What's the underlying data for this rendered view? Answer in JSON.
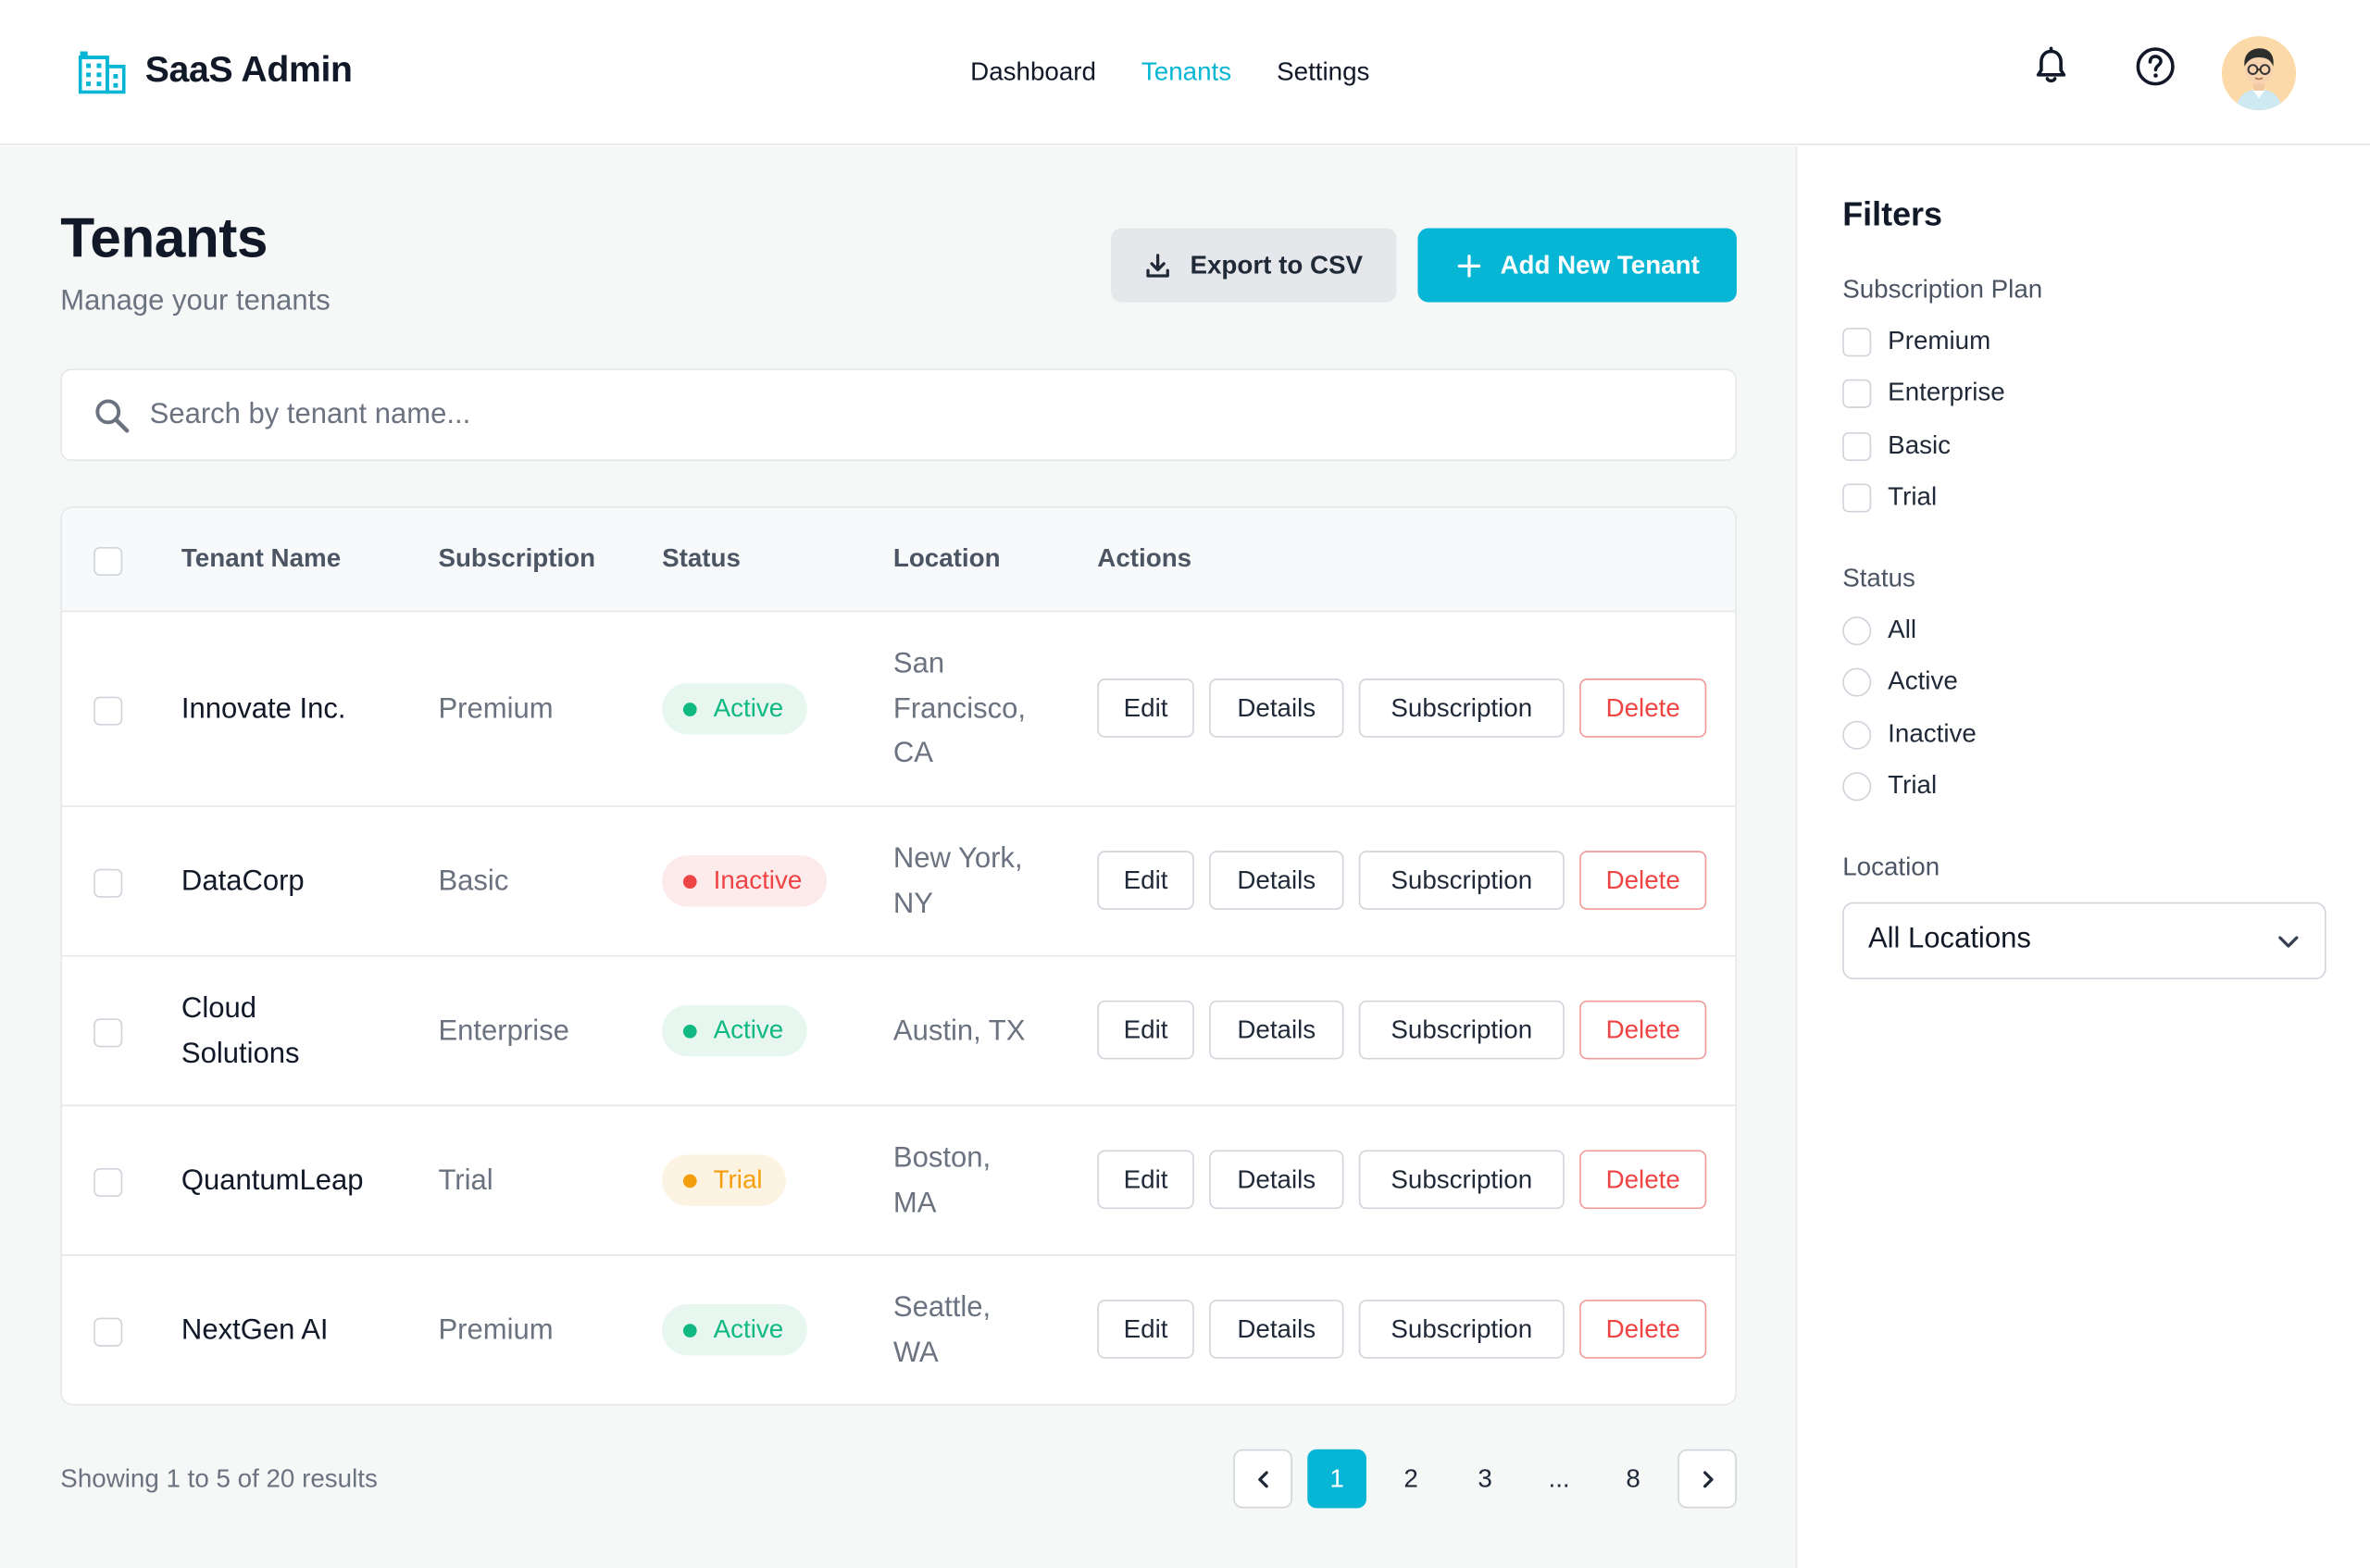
{
  "header": {
    "brand": "SaaS Admin",
    "nav": [
      {
        "label": "Dashboard",
        "active": false
      },
      {
        "label": "Tenants",
        "active": true
      },
      {
        "label": "Settings",
        "active": false
      }
    ],
    "icons": [
      "bell-icon",
      "help-circle-icon"
    ],
    "accent_color": "#06b6d4"
  },
  "page": {
    "title": "Tenants",
    "subtitle": "Manage your tenants",
    "export_label": "Export to CSV",
    "add_label": "Add New Tenant"
  },
  "search": {
    "placeholder": "Search by tenant name...",
    "value": ""
  },
  "table": {
    "columns": [
      "Tenant Name",
      "Subscription",
      "Status",
      "Location",
      "Actions"
    ],
    "actions": [
      "Edit",
      "Details",
      "Subscription",
      "Delete"
    ],
    "rows": [
      {
        "name": "Innovate Inc.",
        "subscription": "Premium",
        "status": "Active",
        "location": "San Francisco, CA"
      },
      {
        "name": "DataCorp",
        "subscription": "Basic",
        "status": "Inactive",
        "location": "New York, NY"
      },
      {
        "name": "Cloud Solutions",
        "subscription": "Enterprise",
        "status": "Active",
        "location": "Austin, TX"
      },
      {
        "name": "QuantumLeap",
        "subscription": "Trial",
        "status": "Trial",
        "location": "Boston, MA"
      },
      {
        "name": "NextGen AI",
        "subscription": "Premium",
        "status": "Active",
        "location": "Seattle, WA"
      }
    ]
  },
  "pagination": {
    "summary": "Showing 1 to 5 of 20 results",
    "pages": [
      "1",
      "2",
      "3",
      "...",
      "8"
    ],
    "current": "1"
  },
  "filters": {
    "title": "Filters",
    "plan_label": "Subscription Plan",
    "plans": [
      "Premium",
      "Enterprise",
      "Basic",
      "Trial"
    ],
    "status_label": "Status",
    "statuses": [
      "All",
      "Active",
      "Inactive",
      "Trial"
    ],
    "location_label": "Location",
    "location_value": "All Locations"
  },
  "status_colors": {
    "Active": "#10b981",
    "Inactive": "#ef4444",
    "Trial": "#f59e0b"
  }
}
